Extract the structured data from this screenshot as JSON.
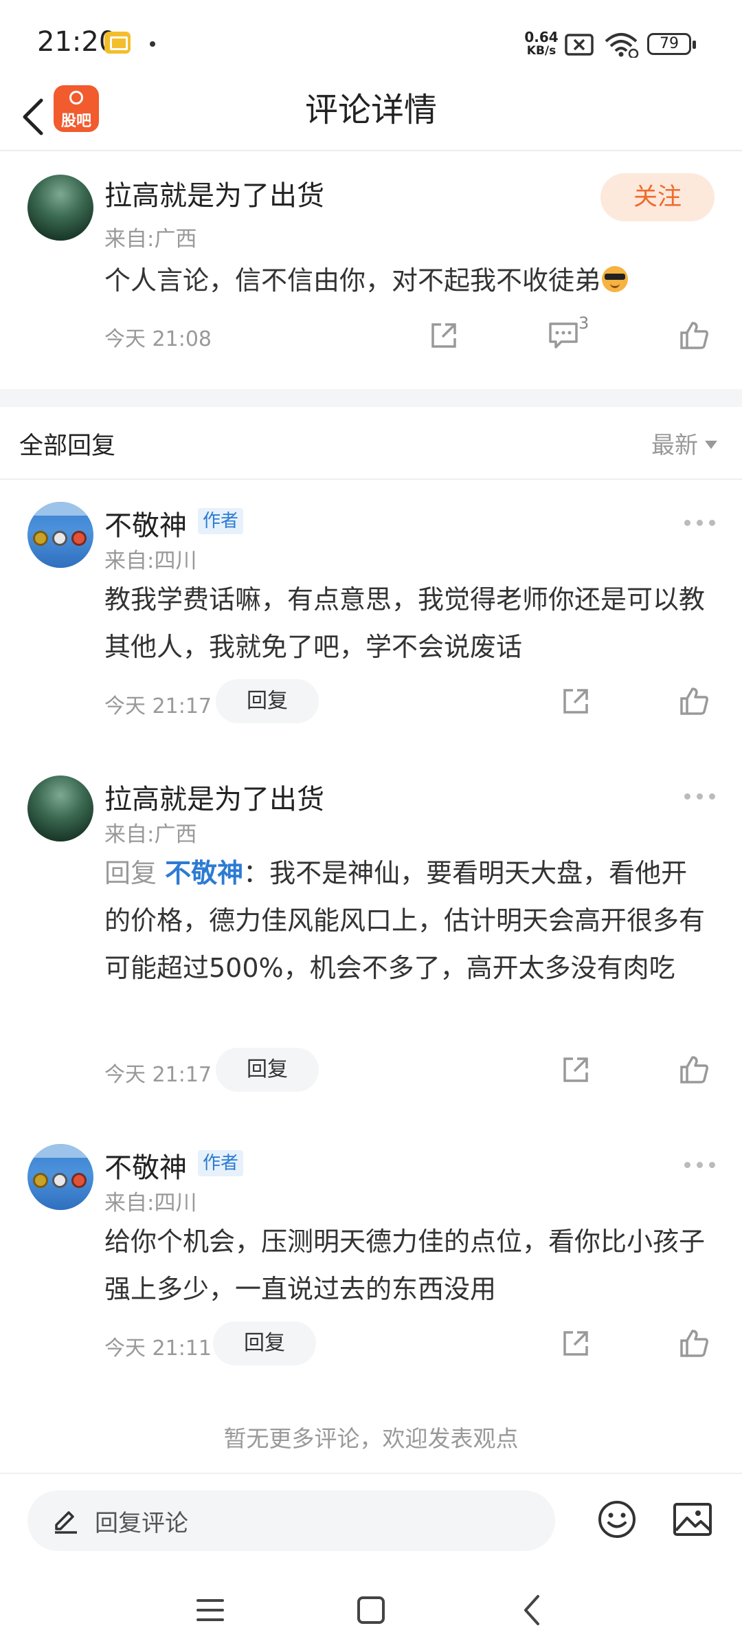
{
  "status_bar": {
    "time": "21:20",
    "net_speed_value": "0.64",
    "net_speed_unit": "KB/s",
    "battery": "79"
  },
  "nav": {
    "title": "评论详情",
    "logo_text": "股吧"
  },
  "main_comment": {
    "username": "拉高就是为了出货",
    "location": "来自:广西",
    "content": "个人言论，信不信由你，对不起我不收徒弟",
    "time": "今天 21:08",
    "follow_label": "关注",
    "comment_count": "3"
  },
  "replies_section": {
    "title": "全部回复",
    "sort_label": "最新"
  },
  "replies": [
    {
      "username": "不敬神",
      "tag": "作者",
      "location": "来自:四川",
      "content": "教我学费话嘛，有点意思，我觉得老师你还是可以教其他人，我就免了吧，学不会说废话",
      "time": "今天 21:17",
      "reply_label": "回复"
    },
    {
      "username": "拉高就是为了出货",
      "location": "来自:广西",
      "reply_prefix": "回复",
      "reply_to": "不敬神",
      "content": "：我不是神仙，要看明天大盘，看他开的价格，德力佳风能风口上，估计明天会高开很多有可能超过500%，机会不多了，高开太多没有肉吃",
      "time": "今天 21:17",
      "reply_label": "回复"
    },
    {
      "username": "不敬神",
      "tag": "作者",
      "location": "来自:四川",
      "content": "给你个机会，压测明天德力佳的点位，看你比小孩子强上多少，一直说过去的东西没用",
      "time": "今天 21:11",
      "reply_label": "回复"
    }
  ],
  "no_more_text": "暂无更多评论，欢迎发表观点",
  "input_bar": {
    "placeholder": "回复评论"
  },
  "colors": {
    "accent_orange": "#ef6b2c",
    "link_blue": "#2c7bd3",
    "muted_text": "#999999"
  }
}
